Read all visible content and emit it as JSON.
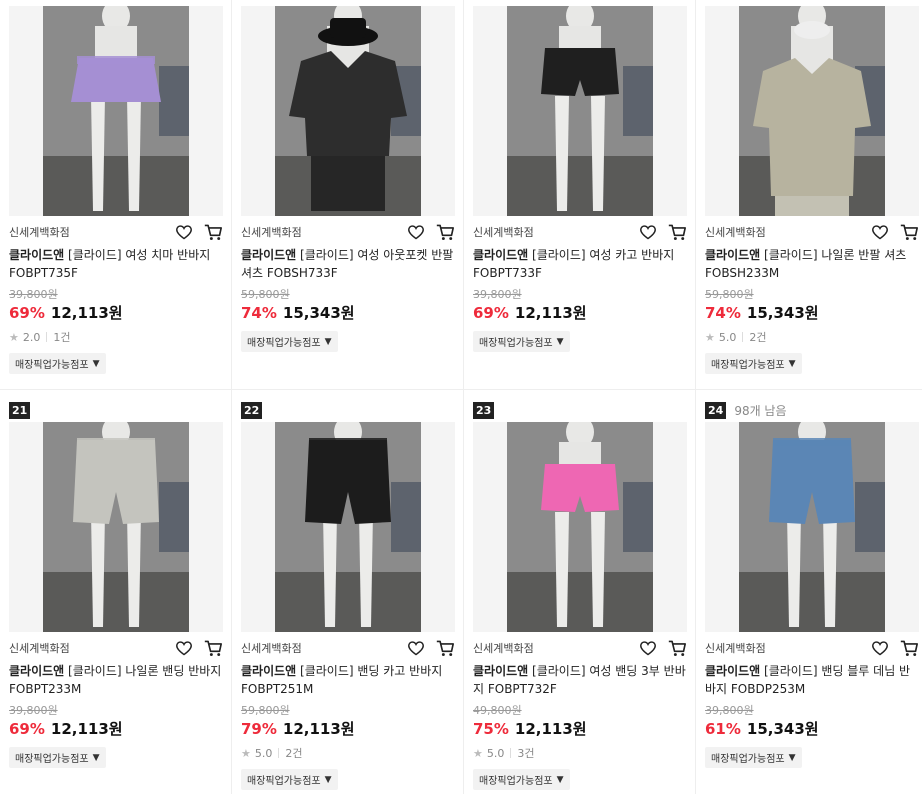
{
  "products": [
    {
      "store": "신세계백화점",
      "brand": "클라이드앤",
      "title": "[클라이드] 여성 치마 반바지 FOBPT735F",
      "orig": "39,800원",
      "disc": "69%",
      "price": "12,113원",
      "rating": "2.0",
      "reviews": "1건",
      "tag": "매장픽업가능점포",
      "color": "#a58fd3",
      "mannequin": "skirt"
    },
    {
      "store": "신세계백화점",
      "brand": "클라이드앤",
      "title": "[클라이드] 여성 아웃포켓 반팔 셔츠 FOBSH733F",
      "orig": "59,800원",
      "disc": "74%",
      "price": "15,343원",
      "rating": "",
      "reviews": "",
      "tag": "매장픽업가능점포",
      "color": "#2d2d2d",
      "mannequin": "shirt-dark"
    },
    {
      "store": "신세계백화점",
      "brand": "클라이드앤",
      "title": "[클라이드] 여성 카고 반바지 FOBPT733F",
      "orig": "39,800원",
      "disc": "69%",
      "price": "12,113원",
      "rating": "",
      "reviews": "",
      "tag": "매장픽업가능점포",
      "color": "#1f1f1f",
      "mannequin": "shorts-high"
    },
    {
      "store": "신세계백화점",
      "brand": "클라이드앤",
      "title": "[클라이드] 나일론 반팔 셔츠 FOBSH233M",
      "orig": "59,800원",
      "disc": "74%",
      "price": "15,343원",
      "rating": "5.0",
      "reviews": "2건",
      "tag": "매장픽업가능점포",
      "color": "#b7b39f",
      "mannequin": "shirt-light"
    },
    {
      "rank": "21",
      "note": "",
      "store": "신세계백화점",
      "brand": "클라이드앤",
      "title": "[클라이드] 나일론 밴딩 반바지 FOBPT233M",
      "orig": "39,800원",
      "disc": "69%",
      "price": "12,113원",
      "rating": "",
      "reviews": "",
      "tag": "매장픽업가능점포",
      "color": "#c4c4be",
      "mannequin": "long-shorts"
    },
    {
      "rank": "22",
      "note": "",
      "store": "신세계백화점",
      "brand": "클라이드앤",
      "title": "[클라이드] 밴딩 카고 반바지 FOBPT251M",
      "orig": "59,800원",
      "disc": "79%",
      "price": "12,113원",
      "rating": "5.0",
      "reviews": "2건",
      "tag": "매장픽업가능점포",
      "color": "#1c1c1c",
      "mannequin": "long-shorts"
    },
    {
      "rank": "23",
      "note": "",
      "store": "신세계백화점",
      "brand": "클라이드앤",
      "title": "[클라이드] 여성 밴딩 3부 반바지 FOBPT732F",
      "orig": "49,800원",
      "disc": "75%",
      "price": "12,113원",
      "rating": "5.0",
      "reviews": "3건",
      "tag": "매장픽업가능점포",
      "color": "#ee67b3",
      "mannequin": "shorts-high"
    },
    {
      "rank": "24",
      "note": "98개 남음",
      "store": "신세계백화점",
      "brand": "클라이드앤",
      "title": "[클라이드] 밴딩 블루 데님 반바지 FOBDP253M",
      "orig": "39,800원",
      "disc": "61%",
      "price": "15,343원",
      "rating": "",
      "reviews": "",
      "tag": "매장픽업가능점포",
      "color": "#5b86b5",
      "mannequin": "long-shorts"
    }
  ]
}
